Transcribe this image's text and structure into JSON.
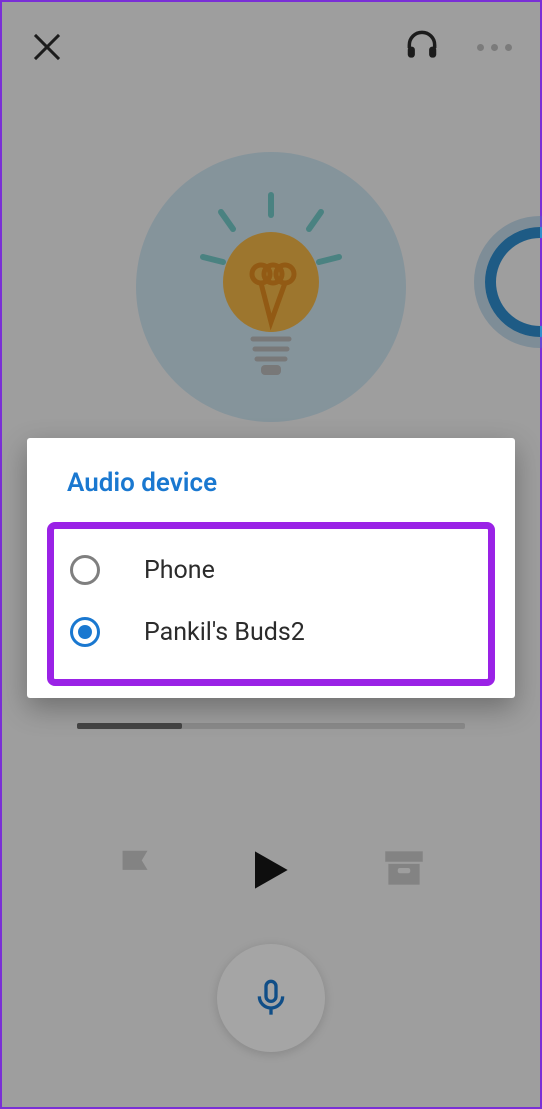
{
  "dialog": {
    "title": "Audio device",
    "options": [
      {
        "label": "Phone",
        "selected": false
      },
      {
        "label": "Pankil's Buds2",
        "selected": true
      }
    ]
  },
  "colors": {
    "accent": "#1a78d0",
    "highlight": "#9a22e6"
  },
  "icons": {
    "close": "close-icon",
    "headphones": "headphones-icon",
    "more": "more-icon",
    "flag": "flag-icon",
    "play": "play-icon",
    "archive": "archive-icon",
    "mic": "mic-icon",
    "bulb": "bulb-icon"
  },
  "progress": {
    "percent": 27
  }
}
